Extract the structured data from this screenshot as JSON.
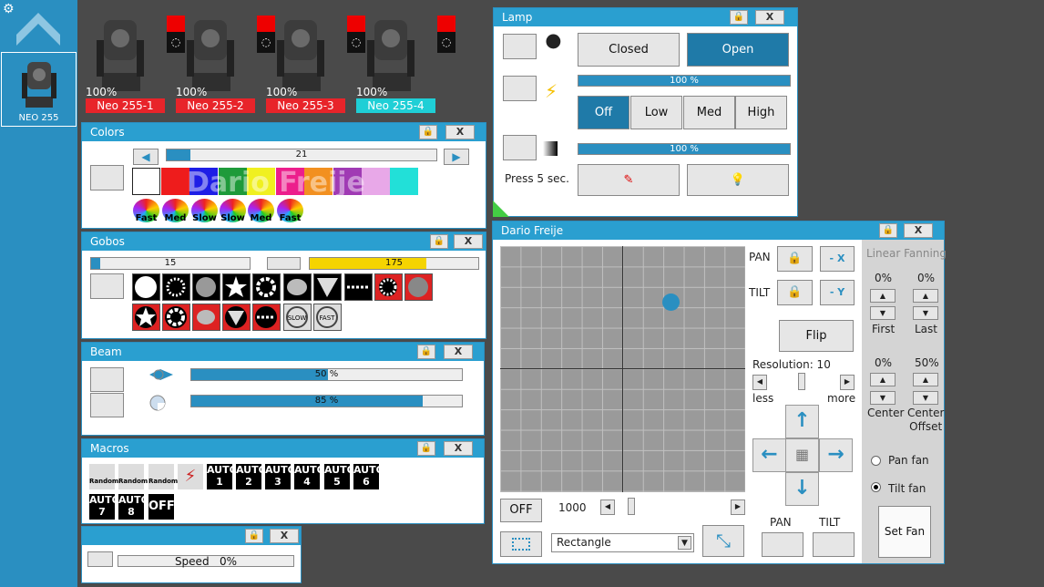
{
  "sidebar": {
    "fixture_label": "NEO 255"
  },
  "fixtures": [
    {
      "pct": "100%",
      "name": "Neo 255-1",
      "color": "#e8242a"
    },
    {
      "pct": "100%",
      "name": "Neo 255-2",
      "color": "#e8242a"
    },
    {
      "pct": "100%",
      "name": "Neo 255-3",
      "color": "#e8242a"
    },
    {
      "pct": "100%",
      "name": "Neo 255-4",
      "color": "#1fcfd6"
    }
  ],
  "colors": {
    "title": "Colors",
    "slider_value": "21",
    "speeds": [
      "Fast",
      "Med",
      "Slow",
      "Slow",
      "Med",
      "Fast"
    ],
    "watermark": "Dario Freije"
  },
  "gobos": {
    "title": "Gobos",
    "left_value": "15",
    "right_value": "175",
    "slow": "SLOW",
    "fast": "FAST"
  },
  "beam": {
    "title": "Beam",
    "bar1": "50 %",
    "bar2": "85 %"
  },
  "macros": {
    "title": "Macros",
    "icons": [
      "Random",
      "Random",
      "Random"
    ],
    "autos": [
      "AUTO\n1",
      "AUTO\n2",
      "AUTO\n3",
      "AUTO\n4",
      "AUTO\n5",
      "AUTO\n6",
      "AUTO\n7",
      "AUTO\n8"
    ],
    "off": "OFF"
  },
  "speed": {
    "label": "Speed",
    "value": "0%"
  },
  "lamp": {
    "title": "Lamp",
    "closed": "Closed",
    "open": "Open",
    "bar1": "100 %",
    "off": "Off",
    "low": "Low",
    "med": "Med",
    "high": "High",
    "bar2": "100 %",
    "press": "Press 5 sec."
  },
  "pantilt": {
    "title": "Dario Freije",
    "pan": "PAN",
    "tilt": "TILT",
    "minus_x": "- X",
    "minus_y": "- Y",
    "flip": "Flip",
    "resolution": "Resolution: 10",
    "less": "less",
    "more": "more",
    "off": "OFF",
    "value": "1000",
    "shape": "Rectangle",
    "pan2": "PAN",
    "tilt2": "TILT"
  },
  "fanning": {
    "title": "Linear Fanning",
    "first_pct": "0%",
    "last_pct": "0%",
    "first": "First",
    "last": "Last",
    "center_pct": "0%",
    "offset_pct": "50%",
    "center": "Center",
    "center_offset": "Center\nOffset",
    "pan_fan": "Pan fan",
    "tilt_fan": "Tilt fan",
    "set_fan": "Set Fan"
  }
}
